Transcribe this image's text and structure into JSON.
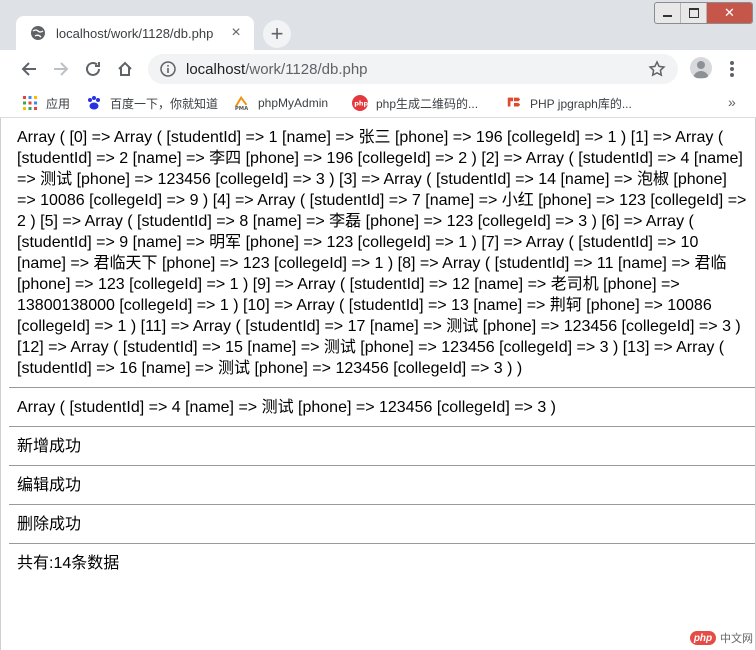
{
  "browser": {
    "tab_title": "localhost/work/1128/db.php",
    "url_host": "localhost",
    "url_path": "/work/1128/db.php",
    "accent": "#1a73e8"
  },
  "bookmarks": [
    {
      "label": "应用",
      "icon": "apps-grid-icon"
    },
    {
      "label": "百度一下，你就知道",
      "icon": "baidu-paw-icon"
    },
    {
      "label": "phpMyAdmin",
      "icon": "phpmyadmin-icon"
    },
    {
      "label": "php生成二维码的...",
      "icon": "php-red-icon"
    },
    {
      "label": "PHP jpgraph库的...",
      "icon": "jpgraph-icon"
    }
  ],
  "content": {
    "array_all": "Array ( [0] => Array ( [studentId] => 1 [name] => 张三 [phone] => 196 [collegeId] => 1 ) [1] => Array ( [studentId] => 2 [name] => 李四 [phone] => 196 [collegeId] => 2 ) [2] => Array ( [studentId] => 4 [name] => 测试 [phone] => 123456 [collegeId] => 3 ) [3] => Array ( [studentId] => 14 [name] => 泡椒 [phone] => 10086 [collegeId] => 9 ) [4] => Array ( [studentId] => 7 [name] => 小红 [phone] => 123 [collegeId] => 2 ) [5] => Array ( [studentId] => 8 [name] => 李磊 [phone] => 123 [collegeId] => 3 ) [6] => Array ( [studentId] => 9 [name] => 明军 [phone] => 123 [collegeId] => 1 ) [7] => Array ( [studentId] => 10 [name] => 君临天下 [phone] => 123 [collegeId] => 1 ) [8] => Array ( [studentId] => 11 [name] => 君临 [phone] => 123 [collegeId] => 1 ) [9] => Array ( [studentId] => 12 [name] => 老司机 [phone] => 13800138000 [collegeId] => 1 ) [10] => Array ( [studentId] => 13 [name] => 荆轲 [phone] => 10086 [collegeId] => 1 ) [11] => Array ( [studentId] => 17 [name] => 测试 [phone] => 123456 [collegeId] => 3 ) [12] => Array ( [studentId] => 15 [name] => 测试 [phone] => 123456 [collegeId] => 3 ) [13] => Array ( [studentId] => 16 [name] => 测试 [phone] => 123456 [collegeId] => 3 ) )",
    "array_one": "Array ( [studentId] => 4 [name] => 测试 [phone] => 123456 [collegeId] => 3 )",
    "msg_add": "新增成功",
    "msg_edit": "编辑成功",
    "msg_delete": "删除成功",
    "msg_total": "共有:14条数据"
  },
  "watermark": {
    "logo_text": "php",
    "site": "中文网"
  }
}
